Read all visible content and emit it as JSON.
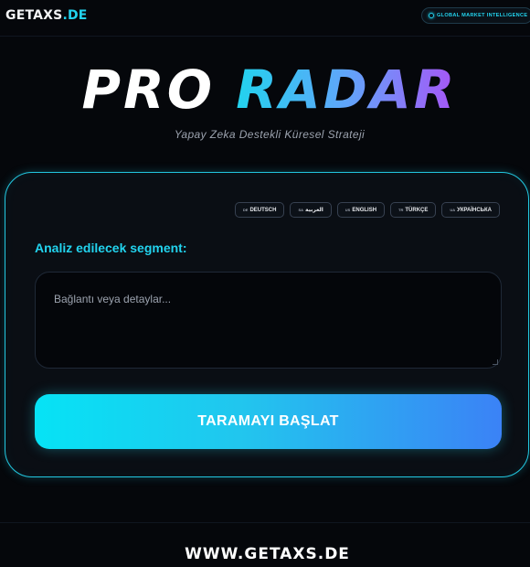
{
  "header": {
    "logo_main": "GETAXS",
    "logo_suffix": ".DE",
    "badge_label": "GLOBAL MARKET INTELLIGENCE"
  },
  "hero": {
    "title_word1": "PRO",
    "title_word2": "RADAR",
    "subtitle": "Yapay Zeka Destekli Küresel Strateji"
  },
  "languages": [
    {
      "code": "DE",
      "label": "DEUTSCH"
    },
    {
      "code": "SA",
      "label": "العربية"
    },
    {
      "code": "US",
      "label": "ENGLISH"
    },
    {
      "code": "TR",
      "label": "TÜRKÇE"
    },
    {
      "code": "UA",
      "label": "УКРАЇНСЬКА"
    }
  ],
  "form": {
    "segment_label": "Analiz edilecek segment:",
    "textarea_placeholder": "Bağlantı veya detaylar...",
    "submit_label": "TARAMAYI BAŞLAT"
  },
  "footer": {
    "site": "WWW.GETAXS.DE"
  },
  "colors": {
    "accent": "#22d3ee",
    "background": "#05070b",
    "gradient_end": "#a855f7"
  }
}
